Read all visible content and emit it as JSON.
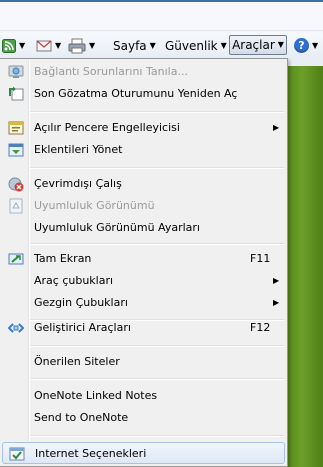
{
  "toolbar": {
    "page_label": "Sayfa",
    "safety_label": "Güvenlik",
    "tools_label": "Araçlar",
    "dropdown_arrow": "▼",
    "help_glyph": "?"
  },
  "menu": {
    "items": [
      {
        "label": "Bağlantı Sorunlarını Tanıla...",
        "icon": "diagnose-icon",
        "disabled": true
      },
      {
        "label": "Son Gözatma Oturumunu Yeniden Aç",
        "icon": "reopen-session-icon"
      },
      {
        "label": "Açılır Pencere Engelleyicisi",
        "icon": "popup-blocker-icon",
        "submenu": "▶"
      },
      {
        "label": "Eklentileri Yönet",
        "icon": "addons-icon"
      },
      {
        "label": "Çevrimdışı Çalış",
        "icon": "offline-icon"
      },
      {
        "label": "Uyumluluk Görünümü",
        "icon": "compat-view-icon",
        "disabled": true
      },
      {
        "label": "Uyumluluk Görünümü Ayarları"
      },
      {
        "label": "Tam Ekran",
        "icon": "fullscreen-icon",
        "shortcut": "F11"
      },
      {
        "label": "Araç çubukları",
        "submenu": "▶"
      },
      {
        "label": "Gezgin Çubukları",
        "submenu": "▶"
      },
      {
        "label": "Geliştirici Araçları",
        "icon": "developer-tools-icon",
        "shortcut": "F12"
      },
      {
        "label": "Önerilen Siteler"
      },
      {
        "label": "OneNote Linked Notes"
      },
      {
        "label": "Send to OneNote"
      },
      {
        "label": "Internet Seçenekleri",
        "icon": "internet-options-icon"
      }
    ]
  }
}
